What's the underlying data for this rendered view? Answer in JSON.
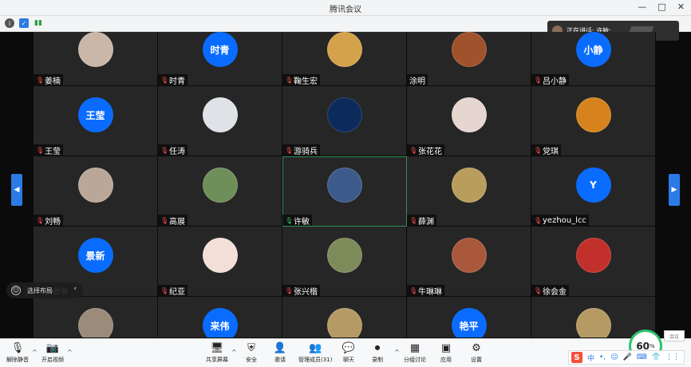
{
  "window": {
    "title": "腾讯会议",
    "minimize": "—",
    "maximize": "□",
    "close": "✕"
  },
  "status": {
    "speaking_label": "正在讲话: 许敏;"
  },
  "participants": [
    {
      "name": "姜楠",
      "avatar": {
        "type": "image",
        "color": "#c9b7a7"
      },
      "mic": "muted"
    },
    {
      "name": "时青",
      "avatar": {
        "type": "text",
        "text": "时青",
        "color": "#0a6cff"
      },
      "mic": "muted"
    },
    {
      "name": "鞠生宏",
      "avatar": {
        "type": "image",
        "color": "#d4a24a"
      },
      "mic": "muted"
    },
    {
      "name": "涂明",
      "avatar": {
        "type": "image",
        "color": "#a0522d"
      },
      "mic": "none"
    },
    {
      "name": "吕小静",
      "avatar": {
        "type": "text",
        "text": "小静",
        "color": "#0a6cff"
      },
      "mic": "muted"
    },
    {
      "name": "王莹",
      "avatar": {
        "type": "text",
        "text": "王莹",
        "color": "#0a6cff"
      },
      "mic": "muted"
    },
    {
      "name": "任涛",
      "avatar": {
        "type": "image",
        "color": "#dfe3e8"
      },
      "mic": "muted"
    },
    {
      "name": "游骑兵",
      "avatar": {
        "type": "image",
        "color": "#0c2a5a"
      },
      "mic": "muted"
    },
    {
      "name": "张花花",
      "avatar": {
        "type": "image",
        "color": "#e6d6d0"
      },
      "mic": "muted"
    },
    {
      "name": "党琪",
      "avatar": {
        "type": "image",
        "color": "#d6831e"
      },
      "mic": "muted"
    },
    {
      "name": "刘畅",
      "avatar": {
        "type": "image",
        "color": "#b9a89a"
      },
      "mic": "muted"
    },
    {
      "name": "高展",
      "avatar": {
        "type": "image",
        "color": "#6f8f5a"
      },
      "mic": "muted"
    },
    {
      "name": "许敏",
      "avatar": {
        "type": "image",
        "color": "#3d5b8a"
      },
      "mic": "active"
    },
    {
      "name": "薛渊",
      "avatar": {
        "type": "image",
        "color": "#b89d5c"
      },
      "mic": "muted"
    },
    {
      "name": "yezhou_lcc",
      "avatar": {
        "type": "text",
        "text": "Y",
        "color": "#0a6cff"
      },
      "mic": "muted"
    },
    {
      "name": "张景新",
      "avatar": {
        "type": "text",
        "text": "景新",
        "color": "#0a6cff"
      },
      "mic": "muted"
    },
    {
      "name": "纪亚",
      "avatar": {
        "type": "image",
        "color": "#f2dfd7"
      },
      "mic": "muted"
    },
    {
      "name": "张兴楷",
      "avatar": {
        "type": "image",
        "color": "#7d8a5a"
      },
      "mic": "muted"
    },
    {
      "name": "牛琳琳",
      "avatar": {
        "type": "image",
        "color": "#a9583b"
      },
      "mic": "muted"
    },
    {
      "name": "徐会金",
      "avatar": {
        "type": "image",
        "color": "#c2302b"
      },
      "mic": "muted"
    },
    {
      "name": "",
      "avatar": {
        "type": "image",
        "color": "#9b8b7a"
      },
      "mic": "none"
    },
    {
      "name": "",
      "avatar": {
        "type": "text",
        "text": "来伟",
        "color": "#0a6cff"
      },
      "mic": "none"
    },
    {
      "name": "",
      "avatar": {
        "type": "image",
        "color": "#b59b63"
      },
      "mic": "none"
    },
    {
      "name": "",
      "avatar": {
        "type": "text",
        "text": "艳平",
        "color": "#0a6cff"
      },
      "mic": "none"
    },
    {
      "name": "",
      "avatar": {
        "type": "image",
        "color": "#b59b63"
      },
      "mic": "none"
    }
  ],
  "layout_pill": {
    "label": "选择布局"
  },
  "toolbar": {
    "unmute": "解除静音",
    "video": "开启视频",
    "share": "共享屏幕",
    "security": "安全",
    "invite": "邀请",
    "members": "管理成员(31)",
    "chat": "聊天",
    "record": "录制",
    "breakout": "分组讨论",
    "apps": "应用",
    "settings": "设置"
  },
  "indicator": {
    "percent": "60",
    "percent_unit": "%",
    "side_label": "会议"
  },
  "ime": {
    "logo": "S",
    "items": [
      "中",
      "•,",
      "☺",
      "🎤",
      "⌨",
      "👕",
      "⋮⋮"
    ]
  },
  "colors": {
    "accent": "#0a6cff",
    "active_border": "#2d8f57",
    "muted_mic": "#ff4d4d",
    "active_mic": "#37c26b"
  }
}
